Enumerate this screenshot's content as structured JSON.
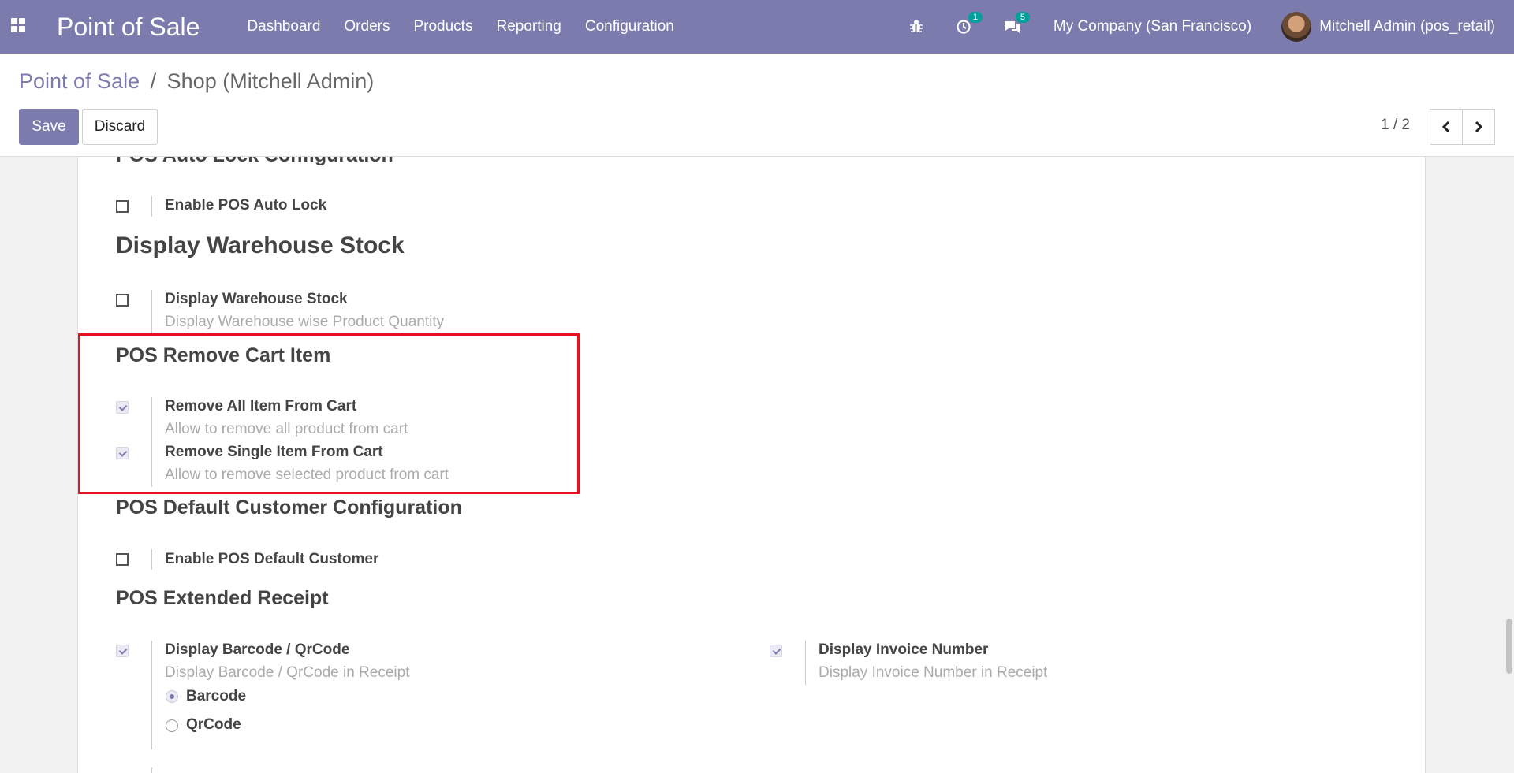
{
  "navbar": {
    "app_title": "Point of Sale",
    "menu": [
      "Dashboard",
      "Orders",
      "Products",
      "Reporting",
      "Configuration"
    ],
    "activity_count": "1",
    "message_count": "5",
    "company": "My Company (San Francisco)",
    "user": "Mitchell Admin (pos_retail)"
  },
  "breadcrumb": {
    "parent": "Point of Sale",
    "separator": "/",
    "current": "Shop (Mitchell Admin)"
  },
  "buttons": {
    "save": "Save",
    "discard": "Discard"
  },
  "pager": {
    "value": "1 / 2"
  },
  "sections": {
    "auto_lock": {
      "title": "POS Auto Lock Configuration",
      "setting": {
        "label": "Enable POS Auto Lock",
        "checked": false
      }
    },
    "warehouse": {
      "title": "Display Warehouse Stock",
      "setting": {
        "label": "Display Warehouse Stock",
        "help": "Display Warehouse wise Product Quantity",
        "checked": false
      }
    },
    "remove_cart": {
      "title": "POS Remove Cart Item",
      "all": {
        "label": "Remove All Item From Cart",
        "help": "Allow to remove all product from cart",
        "checked": true
      },
      "single": {
        "label": "Remove Single Item From Cart",
        "help": "Allow to remove selected product from cart",
        "checked": true
      }
    },
    "default_customer": {
      "title": "POS Default Customer Configuration",
      "setting": {
        "label": "Enable POS Default Customer",
        "checked": false
      }
    },
    "receipt": {
      "title": "POS Extended Receipt",
      "barcode": {
        "label": "Display Barcode / QrCode",
        "help": "Display Barcode / QrCode in Receipt",
        "checked": true,
        "options": [
          "Barcode",
          "QrCode"
        ],
        "selected": "Barcode"
      },
      "invoice": {
        "label": "Display Invoice Number",
        "help": "Display Invoice Number in Receipt",
        "checked": true
      }
    }
  },
  "colors": {
    "brand": "#7c7bad",
    "highlight": "#e8121b",
    "badge": "#00a09d"
  }
}
